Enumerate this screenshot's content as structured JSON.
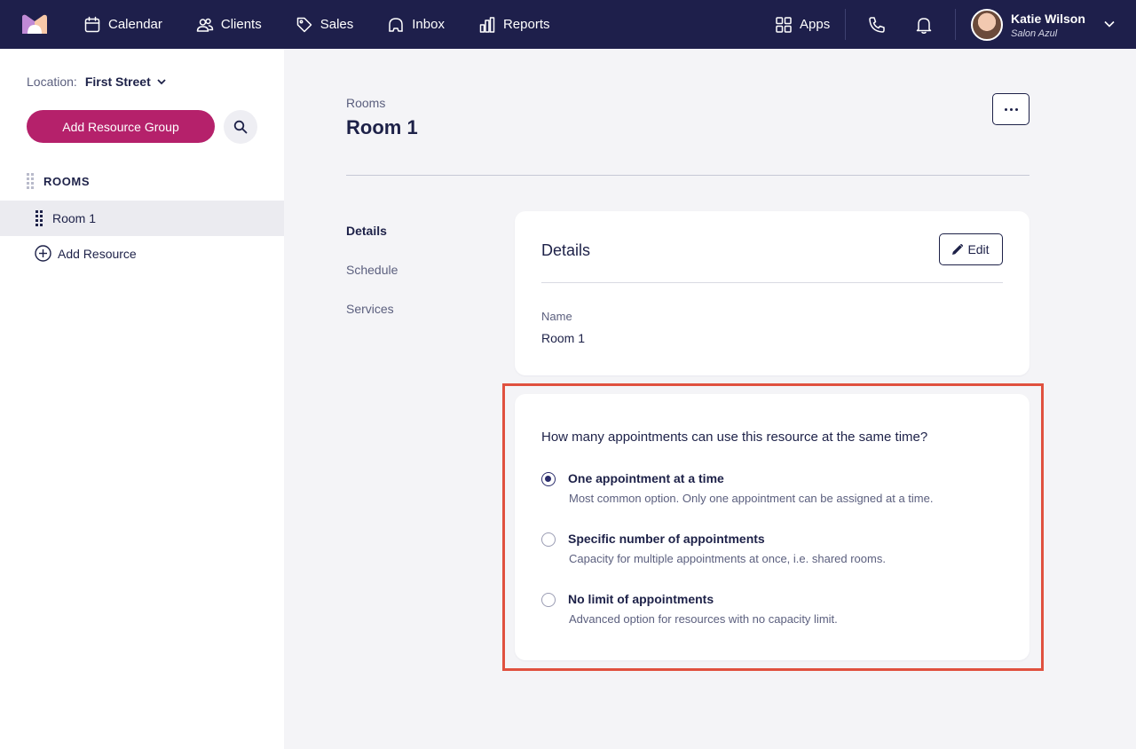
{
  "nav": {
    "items": [
      {
        "label": "Calendar",
        "icon": "calendar-icon"
      },
      {
        "label": "Clients",
        "icon": "clients-icon"
      },
      {
        "label": "Sales",
        "icon": "tag-icon"
      },
      {
        "label": "Inbox",
        "icon": "inbox-icon"
      },
      {
        "label": "Reports",
        "icon": "bar-chart-icon"
      }
    ],
    "apps_label": "Apps",
    "user": {
      "name": "Katie Wilson",
      "org": "Salon Azul"
    }
  },
  "sidebar": {
    "location_label": "Location:",
    "location_value": "First Street",
    "add_group_label": "Add Resource Group",
    "section_title": "ROOMS",
    "room": "Room 1",
    "add_resource_label": "Add Resource"
  },
  "main": {
    "breadcrumb": "Rooms",
    "title": "Room 1",
    "subnav": [
      "Details",
      "Schedule",
      "Services"
    ],
    "details": {
      "title": "Details",
      "edit_label": "Edit",
      "field_label": "Name",
      "field_value": "Room 1"
    },
    "capacity": {
      "question": "How many appointments can use this resource at the same time?",
      "options": [
        {
          "title": "One appointment at a time",
          "desc": "Most common option. Only one appointment can be assigned at a time.",
          "selected": true
        },
        {
          "title": "Specific number of appointments",
          "desc": "Capacity for multiple appointments at once, i.e. shared rooms.",
          "selected": false
        },
        {
          "title": "No limit of appointments",
          "desc": "Advanced option for resources with no capacity limit.",
          "selected": false
        }
      ]
    }
  },
  "colors": {
    "topbar": "#1e1f4b",
    "primary_button": "#b5216b",
    "highlight_border": "#e0513f"
  }
}
